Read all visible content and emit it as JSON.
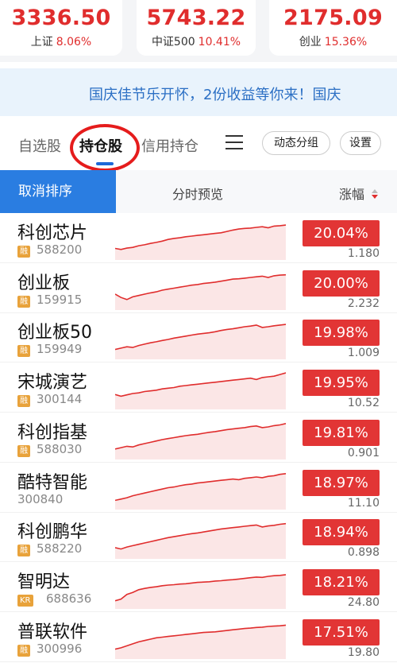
{
  "indices": [
    {
      "value": "3336.50",
      "name": "上证",
      "pct": "8.06%"
    },
    {
      "value": "5743.22",
      "name": "中证500",
      "pct": "10.41%"
    },
    {
      "value": "2175.09",
      "name": "创业",
      "pct": "15.36%"
    }
  ],
  "banner": {
    "text": "国庆佳节乐开怀，2份收益等你来！国庆"
  },
  "tabs": {
    "watchlist": "自选股",
    "holdings": "持仓股",
    "margin": "信用持仓",
    "dynamic_group": "动态分组",
    "settings": "设置"
  },
  "table_header": {
    "cancel_sort": "取消排序",
    "intraday": "分时预览",
    "change": "涨幅"
  },
  "colors": {
    "up": "#e02d2d",
    "accent": "#2a7de1",
    "badge": "#e8a23a"
  },
  "stocks": [
    {
      "name": "科创芯片",
      "tag": "融",
      "code": "588200",
      "pct": "20.04%",
      "vol": "1.180",
      "spark": [
        0.25,
        0.22,
        0.26,
        0.28,
        0.33,
        0.36,
        0.4,
        0.43,
        0.47,
        0.52,
        0.55,
        0.57,
        0.6,
        0.62,
        0.64,
        0.66,
        0.68,
        0.7,
        0.72,
        0.76,
        0.8,
        0.83,
        0.85,
        0.86,
        0.88,
        0.9,
        0.87,
        0.92,
        0.93,
        0.95
      ]
    },
    {
      "name": "创业板",
      "tag": "融",
      "code": "159915",
      "pct": "20.00%",
      "vol": "2.232",
      "spark": [
        0.38,
        0.28,
        0.22,
        0.3,
        0.34,
        0.38,
        0.42,
        0.45,
        0.5,
        0.53,
        0.56,
        0.59,
        0.62,
        0.65,
        0.67,
        0.7,
        0.72,
        0.74,
        0.77,
        0.8,
        0.83,
        0.84,
        0.86,
        0.88,
        0.9,
        0.92,
        0.88,
        0.93,
        0.95,
        0.96
      ]
    },
    {
      "name": "创业板50",
      "tag": "融",
      "code": "159949",
      "pct": "19.98%",
      "vol": "1.009",
      "spark": [
        0.2,
        0.24,
        0.28,
        0.26,
        0.32,
        0.36,
        0.4,
        0.43,
        0.47,
        0.5,
        0.54,
        0.57,
        0.6,
        0.63,
        0.66,
        0.68,
        0.7,
        0.73,
        0.77,
        0.8,
        0.82,
        0.85,
        0.88,
        0.9,
        0.93,
        0.86,
        0.88,
        0.91,
        0.93,
        0.95
      ]
    },
    {
      "name": "宋城演艺",
      "tag": "融",
      "code": "300144",
      "pct": "19.95%",
      "vol": "10.52",
      "spark": [
        0.35,
        0.3,
        0.34,
        0.38,
        0.4,
        0.44,
        0.46,
        0.48,
        0.52,
        0.54,
        0.56,
        0.6,
        0.62,
        0.64,
        0.66,
        0.68,
        0.7,
        0.72,
        0.74,
        0.76,
        0.78,
        0.8,
        0.82,
        0.84,
        0.8,
        0.86,
        0.88,
        0.9,
        0.95,
        1.0
      ]
    },
    {
      "name": "科创指基",
      "tag": "融",
      "code": "588030",
      "pct": "19.81%",
      "vol": "0.901",
      "spark": [
        0.22,
        0.26,
        0.3,
        0.28,
        0.34,
        0.38,
        0.42,
        0.46,
        0.5,
        0.53,
        0.56,
        0.59,
        0.62,
        0.64,
        0.66,
        0.69,
        0.72,
        0.74,
        0.77,
        0.8,
        0.82,
        0.84,
        0.86,
        0.89,
        0.91,
        0.86,
        0.88,
        0.92,
        0.94,
        0.98
      ]
    },
    {
      "name": "酷特智能",
      "tag": "",
      "code": "300840",
      "pct": "18.97%",
      "vol": "11.10",
      "spark": [
        0.18,
        0.22,
        0.26,
        0.32,
        0.36,
        0.4,
        0.44,
        0.48,
        0.52,
        0.56,
        0.58,
        0.62,
        0.65,
        0.67,
        0.7,
        0.72,
        0.74,
        0.76,
        0.78,
        0.8,
        0.82,
        0.8,
        0.84,
        0.86,
        0.88,
        0.86,
        0.9,
        0.92,
        0.96,
        0.98
      ]
    },
    {
      "name": "科创鹏华",
      "tag": "融",
      "code": "588220",
      "pct": "18.94%",
      "vol": "0.898",
      "spark": [
        0.24,
        0.2,
        0.26,
        0.3,
        0.34,
        0.38,
        0.42,
        0.46,
        0.5,
        0.54,
        0.57,
        0.6,
        0.63,
        0.66,
        0.68,
        0.71,
        0.74,
        0.77,
        0.8,
        0.82,
        0.84,
        0.86,
        0.88,
        0.9,
        0.92,
        0.86,
        0.89,
        0.91,
        0.94,
        0.96
      ]
    },
    {
      "name": "智明达",
      "tag": "KR",
      "code": "688636",
      "pct": "18.21%",
      "vol": "24.80",
      "spark": [
        0.15,
        0.2,
        0.34,
        0.4,
        0.48,
        0.52,
        0.55,
        0.57,
        0.6,
        0.62,
        0.63,
        0.65,
        0.66,
        0.68,
        0.7,
        0.71,
        0.72,
        0.74,
        0.75,
        0.77,
        0.78,
        0.8,
        0.82,
        0.84,
        0.86,
        0.85,
        0.88,
        0.9,
        0.91,
        0.93
      ]
    },
    {
      "name": "普联软件",
      "tag": "融",
      "code": "300996",
      "pct": "17.51%",
      "vol": "19.80",
      "spark": [
        0.2,
        0.24,
        0.3,
        0.36,
        0.42,
        0.46,
        0.5,
        0.54,
        0.56,
        0.58,
        0.6,
        0.62,
        0.64,
        0.66,
        0.68,
        0.7,
        0.71,
        0.72,
        0.74,
        0.76,
        0.78,
        0.8,
        0.82,
        0.83,
        0.85,
        0.86,
        0.88,
        0.89,
        0.9,
        0.92
      ]
    }
  ]
}
